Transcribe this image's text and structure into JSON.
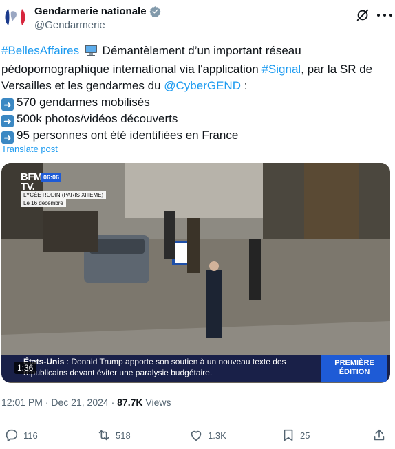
{
  "author": {
    "display_name": "Gendarmerie nationale",
    "handle": "@Gendarmerie"
  },
  "tweet": {
    "hashtag_belles": "#BellesAffaires",
    "text_part1": " Démantèlement d’un important réseau",
    "text_part2": "pédopornographique international via l'application ",
    "hashtag_signal": "#Signal",
    "text_part3": ", par la SR de",
    "text_part4": "Versailles et les gendarmes du ",
    "mention_cybergend": "@CyberGEND",
    "text_part5": " :",
    "bullets": [
      "570 gendarmes mobilisés",
      "500k photos/vidéos découverts",
      "95 personnes ont été identifiées en France"
    ],
    "translate_label": "Translate post"
  },
  "video": {
    "channel": "BFM",
    "channel_sub": "TV.",
    "time": "06:06",
    "location": "LYCÉE RODIN (PARIS XIIIEME)",
    "date": "Le 16 décembre",
    "ticker_prefix": "États-Unis",
    "ticker_text": " : Donald Trump apporte son soutien à un nouveau texte des républicains devant éviter une paralysie budgétaire.",
    "premiere_line1": "PREMIÈRE",
    "premiere_line2": "ÉDITION",
    "duration": "1:36"
  },
  "meta": {
    "time": "12:01 PM",
    "separator": " · ",
    "date": "Dec 21, 2024",
    "views_count": "87.7K",
    "views_label": " Views"
  },
  "actions": {
    "replies": "116",
    "reposts": "518",
    "likes": "1.3K",
    "bookmarks": "25"
  },
  "colors": {
    "link": "#1d9bf0",
    "text": "#0f1419",
    "secondary": "#536471",
    "verified": "#829aab"
  },
  "icons": [
    "verified-badge-icon",
    "grok-icon",
    "more-icon",
    "computer-emoji-icon",
    "arrow-right-emoji-icon",
    "reply-icon",
    "repost-icon",
    "like-icon",
    "bookmark-icon",
    "share-icon"
  ]
}
